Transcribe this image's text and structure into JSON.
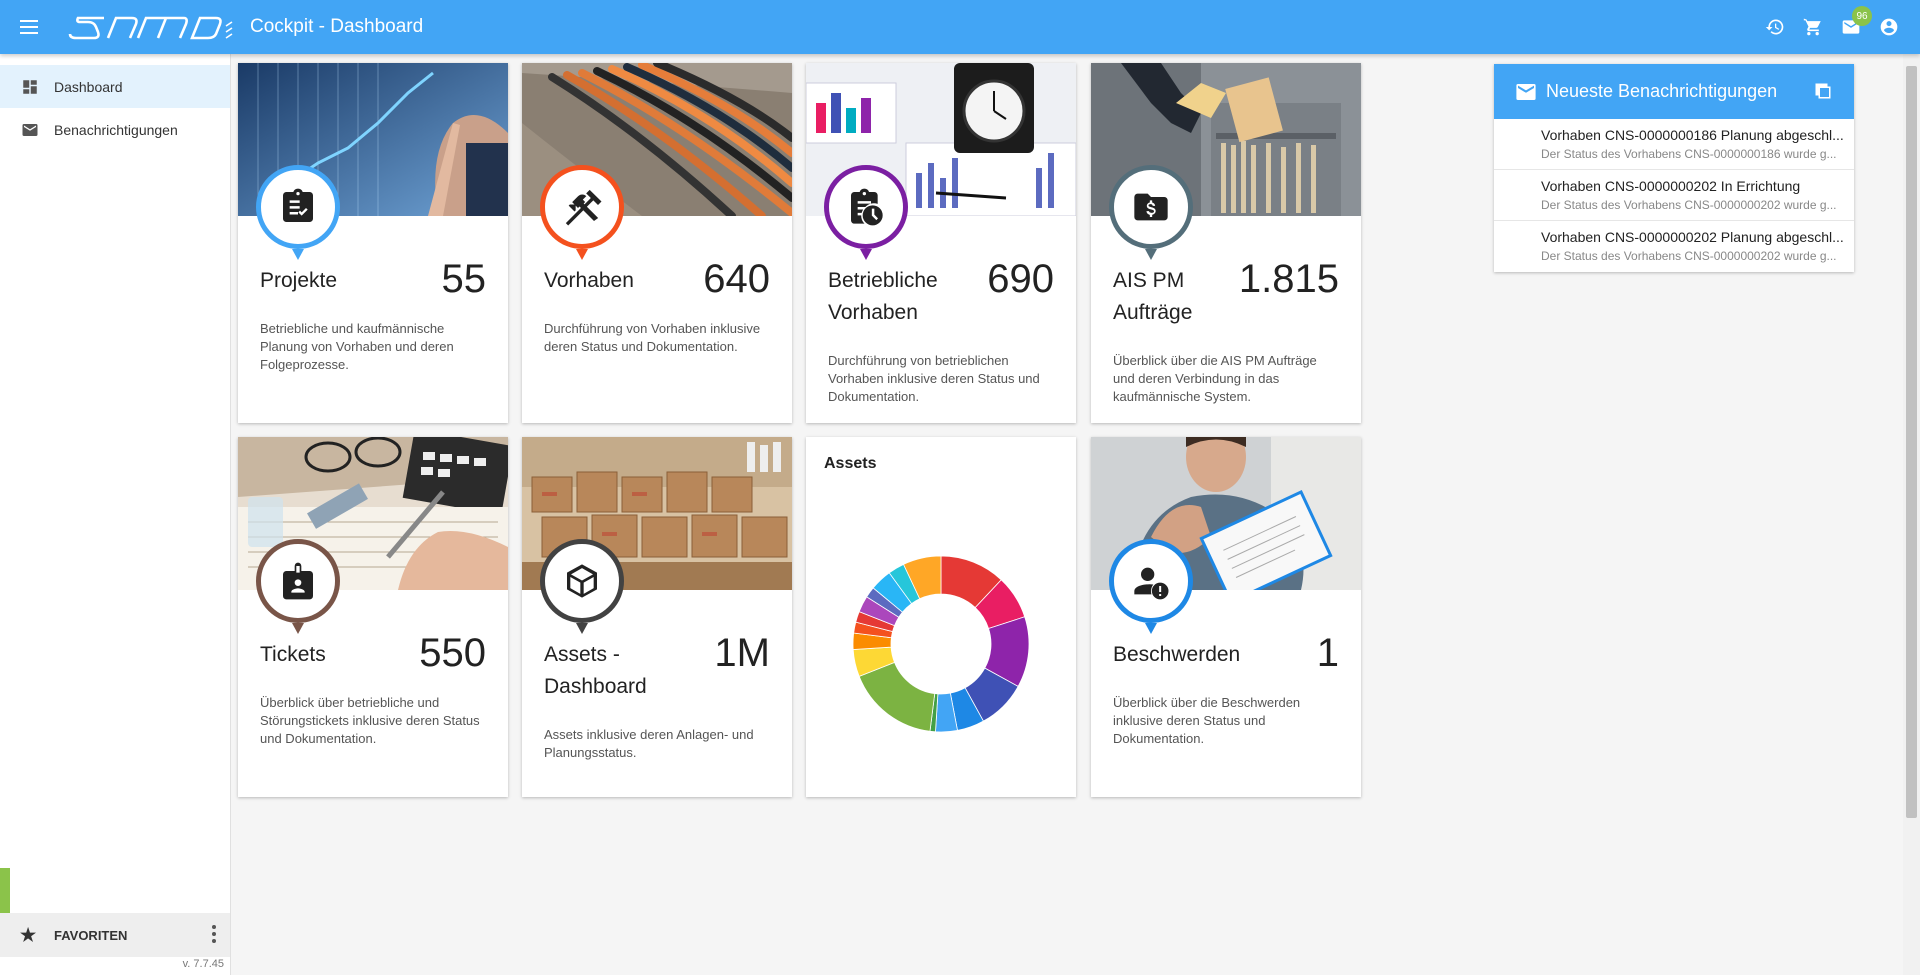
{
  "header": {
    "title": "Cockpit - Dashboard",
    "logo_text": "samo",
    "mail_badge": "96",
    "accent_color": "#42a5f5"
  },
  "sidebar": {
    "items": [
      {
        "label": "Dashboard",
        "icon": "dashboard-icon",
        "active": true
      },
      {
        "label": "Benachrichtigungen",
        "icon": "mail-icon",
        "active": false
      }
    ],
    "favorites_label": "FAVORITEN",
    "version": "v. 7.7.45"
  },
  "cards": [
    {
      "title": "Projekte",
      "value": "55",
      "description": "Betriebliche und kaufmännische Planung von Vorhaben und deren Folgeprozesse.",
      "icon": "clipboard-check-icon",
      "color": "#42a5f5"
    },
    {
      "title": "Vorhaben",
      "value": "640",
      "description": "Durchführung von Vorhaben inklusive deren Status und Dokumentation.",
      "icon": "tools-icon",
      "color": "#f4511e"
    },
    {
      "title": "Betriebliche Vorhaben",
      "value": "690",
      "description": "Durchführung von betrieblichen Vorhaben inklusive deren Status und Dokumentation.",
      "icon": "clipboard-clock-icon",
      "color": "#7b1fa2"
    },
    {
      "title": "AIS PM Aufträge",
      "value": "1.815",
      "description": "Überblick über die AIS PM Aufträge und deren Verbindung in das kaufmännische System.",
      "icon": "money-folder-icon",
      "color": "#546e7a"
    },
    {
      "title": "Tickets",
      "value": "550",
      "description": "Überblick über betriebliche und Störungstickets inklusive deren Status und Dokumentation.",
      "icon": "badge-person-icon",
      "color": "#795548"
    },
    {
      "title": "Assets - Dashboard",
      "value": "1M",
      "description": "Assets inklusive deren Anlagen- und Planungsstatus.",
      "icon": "cube-icon",
      "color": "#424242"
    },
    {
      "title": "Beschwerden",
      "value": "1",
      "description": "Überblick über die Beschwerden inklusive deren Status und Dokumentation.",
      "icon": "person-alert-icon",
      "color": "#1e88e5"
    }
  ],
  "assets_chart": {
    "title": "Assets",
    "chart_data": {
      "type": "pie",
      "title": "Assets",
      "slices": [
        {
          "value": 12,
          "color": "#e53935"
        },
        {
          "value": 8,
          "color": "#e91e63"
        },
        {
          "value": 13,
          "color": "#8e24aa"
        },
        {
          "value": 9,
          "color": "#3f51b5"
        },
        {
          "value": 5,
          "color": "#1e88e5"
        },
        {
          "value": 4,
          "color": "#42a5f5"
        },
        {
          "value": 1,
          "color": "#43a047"
        },
        {
          "value": 17,
          "color": "#7cb342"
        },
        {
          "value": 5,
          "color": "#fdd835"
        },
        {
          "value": 3,
          "color": "#fb8c00"
        },
        {
          "value": 2,
          "color": "#f4511e"
        },
        {
          "value": 2,
          "color": "#e53935"
        },
        {
          "value": 3,
          "color": "#ab47bc"
        },
        {
          "value": 2,
          "color": "#5c6bc0"
        },
        {
          "value": 4,
          "color": "#29b6f6"
        },
        {
          "value": 3,
          "color": "#26c6da"
        },
        {
          "value": 7,
          "color": "#ffa726"
        }
      ]
    }
  },
  "notifications": {
    "title": "Neueste Benachrichtigungen",
    "items": [
      {
        "title": "Vorhaben CNS-0000000186 Planung abgeschl...",
        "subtitle": "Der Status des Vorhabens CNS-0000000186 wurde g..."
      },
      {
        "title": "Vorhaben CNS-0000000202 In Errichtung",
        "subtitle": "Der Status des Vorhabens CNS-0000000202 wurde g..."
      },
      {
        "title": "Vorhaben CNS-0000000202 Planung abgeschl...",
        "subtitle": "Der Status des Vorhabens CNS-0000000202 wurde g..."
      }
    ]
  }
}
